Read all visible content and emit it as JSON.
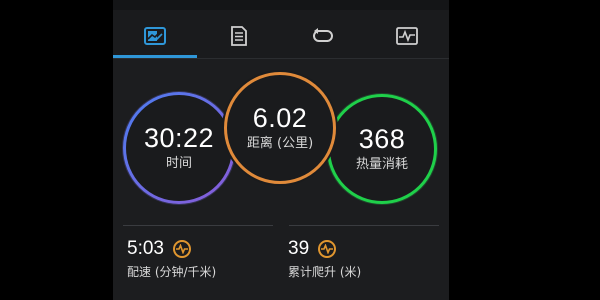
{
  "tabs": [
    {
      "icon": "chart-icon",
      "active": true
    },
    {
      "icon": "document-icon",
      "active": false
    },
    {
      "icon": "loop-icon",
      "active": false
    },
    {
      "icon": "waveform-icon",
      "active": false
    }
  ],
  "rings": {
    "time": {
      "value": "30:22",
      "label": "时间",
      "color": "#5b7cf0"
    },
    "distance": {
      "value": "6.02",
      "label": "距离 (公里)",
      "color": "#e08a3a"
    },
    "calories": {
      "value": "368",
      "label": "热量消耗",
      "color": "#1fd04a"
    }
  },
  "stats": {
    "pace": {
      "value": "5:03",
      "label": "配速 (分钟/千米)"
    },
    "ascent": {
      "value": "39",
      "label": "累计爬升 (米)"
    }
  },
  "colors": {
    "accent": "#2f97d8",
    "stat_icon": "#e0962f",
    "background": "#1a1b1d"
  }
}
